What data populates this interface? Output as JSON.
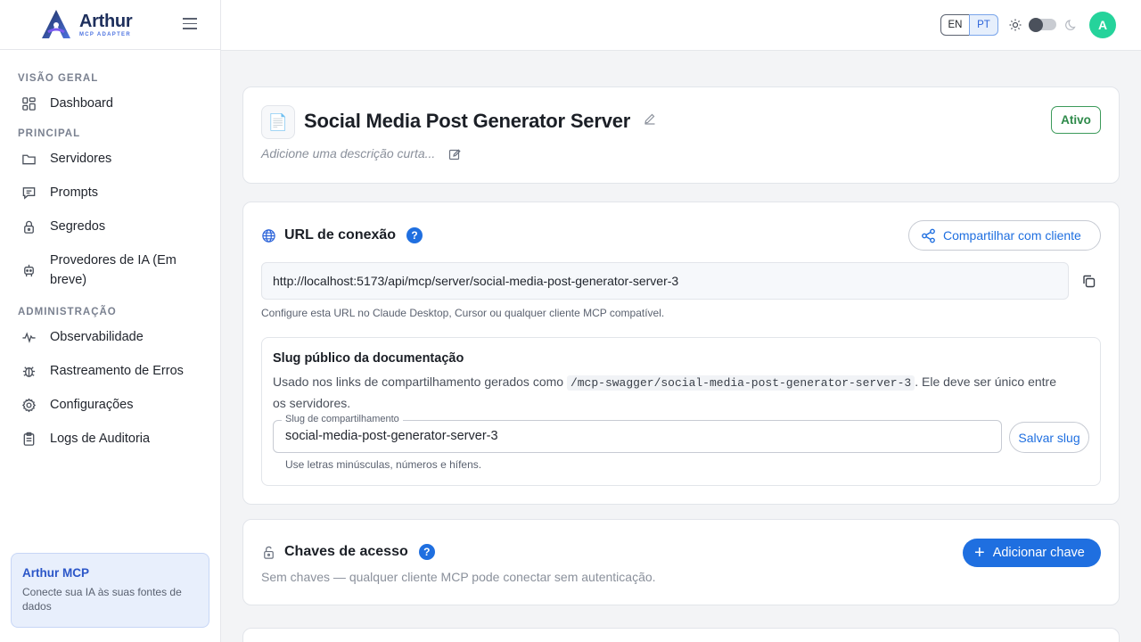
{
  "brand": {
    "name": "Arthur",
    "subtitle": "MCP ADAPTER"
  },
  "sidebar": {
    "sections": [
      {
        "title": "VISÃO GERAL",
        "items": [
          {
            "label": "Dashboard",
            "icon": "dashboard-icon"
          }
        ]
      },
      {
        "title": "PRINCIPAL",
        "items": [
          {
            "label": "Servidores",
            "icon": "folder-icon"
          },
          {
            "label": "Prompts",
            "icon": "chat-icon"
          },
          {
            "label": "Segredos",
            "icon": "lock-icon"
          },
          {
            "label": "Provedores de IA (Em breve)",
            "icon": "robot-icon"
          }
        ]
      },
      {
        "title": "ADMINISTRAÇÃO",
        "items": [
          {
            "label": "Observabilidade",
            "icon": "pulse-icon"
          },
          {
            "label": "Rastreamento de Erros",
            "icon": "bug-icon"
          },
          {
            "label": "Configurações",
            "icon": "gear-icon"
          },
          {
            "label": "Logs de Auditoria",
            "icon": "clipboard-icon"
          }
        ]
      }
    ],
    "promo": {
      "title": "Arthur MCP",
      "text": "Conecte sua IA às suas fontes de dados"
    }
  },
  "topbar": {
    "lang_en": "EN",
    "lang_pt": "PT",
    "selected_lang": "PT",
    "theme_dark": false,
    "avatar_initial": "A"
  },
  "server": {
    "title": "Social Media Post Generator Server",
    "description_placeholder": "Adicione uma descrição curta...",
    "status": "Ativo"
  },
  "connection": {
    "title": "URL de conexão",
    "help": "?",
    "share_label": "Compartilhar com cliente",
    "url": "http://localhost:5173/api/mcp/server/social-media-post-generator-server-3",
    "url_help": "Configure esta URL no Claude Desktop, Cursor ou qualquer cliente MCP compatível.",
    "slug": {
      "title": "Slug público da documentação",
      "desc_before": "Usado nos links de compartilhamento gerados como ",
      "desc_code": "/mcp-swagger/social-media-post-generator-server-3",
      "desc_after": ". Ele deve ser único entre os servidores.",
      "input_label": "Slug de compartilhamento",
      "input_value": "social-media-post-generator-server-3",
      "save_label": "Salvar slug",
      "hint": "Use letras minúsculas, números e hífens."
    }
  },
  "keys": {
    "title": "Chaves de acesso",
    "help": "?",
    "add_label": "Adicionar chave",
    "empty_text": "Sem chaves — qualquer cliente MCP pode conectar sem autenticação."
  },
  "colors": {
    "accent": "#1f6fe0",
    "status_green": "#2e8a4a",
    "avatar": "#25d39b"
  }
}
